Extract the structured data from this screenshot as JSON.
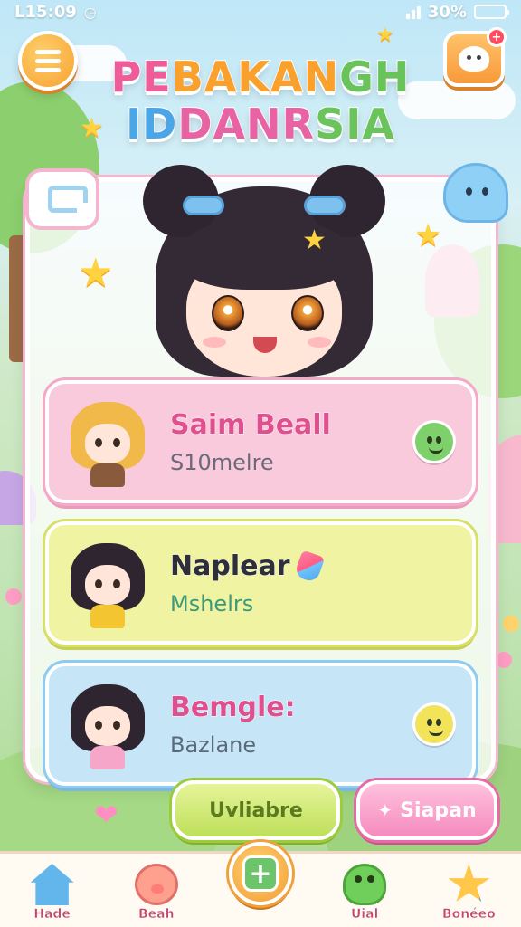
{
  "status_bar": {
    "time": "L15:09",
    "battery_text": "30%",
    "battery_level": 0.3
  },
  "title": {
    "line1": [
      "PE",
      "BAKAN",
      "GH"
    ],
    "line2": [
      "ID",
      "DANR",
      "SIA"
    ]
  },
  "profile": {
    "notification_badge": "+"
  },
  "characters": [
    {
      "name": "Saim Beall",
      "subtitle": "S10melre",
      "name_color": "#e0508f",
      "sub_color": "#6a6a7a",
      "card_color": "#f9c9dc",
      "ring": "#f5a9c8",
      "shade": "#e99cbc",
      "hair": "#f0b94a",
      "outfit": "#8a5a3c",
      "emote": "#7dd06a",
      "emote_icon": "smiley-green-icon"
    },
    {
      "name": "Naplear",
      "subtitle": "Mshelrs",
      "name_color": "#2f2f3a",
      "sub_color": "#3c9a7a",
      "card_color": "#eff3a2",
      "ring": "#d8e06a",
      "shade": "#c7cf55",
      "hair": "#2e2530",
      "outfit": "#f2c531",
      "emote": "",
      "emote_icon": "gem-icon"
    },
    {
      "name": "Bemgle:",
      "subtitle": "Bazlane",
      "name_color": "#e0508f",
      "sub_color": "#5a6a7a",
      "card_color": "#c6e6f8",
      "ring": "#8fcbee",
      "shade": "#7ab8de",
      "hair": "#2e2530",
      "outfit": "#f6a7c9",
      "emote": "#f2e35a",
      "emote_icon": "smiley-yellow-icon"
    }
  ],
  "actions": {
    "primary": "Uvliabre",
    "secondary": "Siapan"
  },
  "nav": [
    {
      "label": "Hade",
      "icon": "home-icon"
    },
    {
      "label": "Beah",
      "icon": "pig-icon"
    },
    {
      "label": "",
      "icon": "plus-icon"
    },
    {
      "label": "Uial",
      "icon": "frog-icon"
    },
    {
      "label": "Bonéeo",
      "icon": "star-icon"
    }
  ]
}
